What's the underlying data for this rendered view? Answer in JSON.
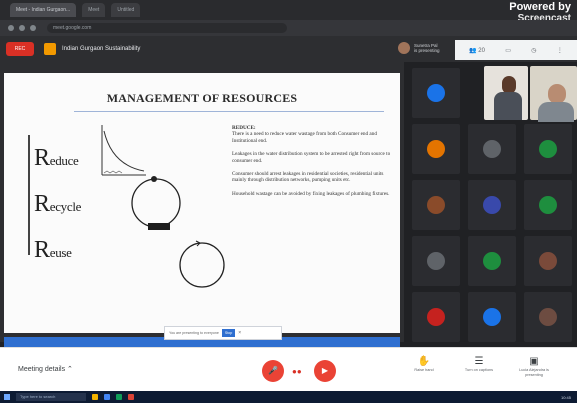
{
  "browser": {
    "tabs": [
      "Meet - Indian Gurgaon...",
      "Meet",
      "Untitled"
    ],
    "url": "meet.google.com",
    "watermark_line1": "Powered by",
    "watermark_line2": "Screencast"
  },
  "meet": {
    "record_label": "REC",
    "title": "Indian Gurgaon Sustainability",
    "presenter_name": "Sunetra Pal",
    "presenter_status": "is presenting",
    "toolbar_icons": [
      "people-icon",
      "chat-icon",
      "clock-icon",
      "more-icon"
    ],
    "toolbar_counts": [
      "20",
      "",
      "",
      ""
    ]
  },
  "slide": {
    "title": "MANAGEMENT OF RESOURCES",
    "r1_cap": "R",
    "r1_rest": "educe",
    "r2_cap": "R",
    "r2_rest": "ecycle",
    "r3_cap": "R",
    "r3_rest": "euse",
    "text": {
      "heading": "REDUCE:",
      "p1": "There is a need to reduce water wastage from both Consumer end and Institutional end.",
      "p2": "Leakages in the water distribution system to be arrested right from source to consumer end.",
      "p3": "Consumer should arrest leakages in residential societies, residential units mainly through distribution networks, pumping units etc.",
      "p4": "Household wastage can be avoided by fixing leakages of plumbing fixtures."
    },
    "present_bar": {
      "text": "You are presenting to everyone",
      "stop_label": "Stop",
      "close": "×"
    }
  },
  "participants": {
    "tile_colors": [
      "#1a73e8",
      "#d93025",
      "#1e8e3e",
      "#e37400",
      "#5f6368",
      "#1e8e3e",
      "#8a4b2a",
      "#3949ab",
      "#1e8e3e",
      "#5f6368",
      "#1e8e3e",
      "#7a4a3a",
      "#c5221f",
      "#1a73e8",
      "#6d4c41"
    ]
  },
  "bottom": {
    "meeting_details": "Meeting details",
    "chevron": "⌃",
    "mic_icon": "mic-off-icon",
    "cam_icon": "cam-off-icon",
    "right_controls": [
      {
        "icon": "raise-hand-icon",
        "label": "Raise hand"
      },
      {
        "icon": "captions-icon",
        "label": "Turn on captions"
      },
      {
        "icon": "present-icon",
        "label": "Lucia Alejandra is presenting"
      }
    ]
  },
  "taskbar": {
    "search_text": "Type here to search",
    "clock": "10:45"
  }
}
